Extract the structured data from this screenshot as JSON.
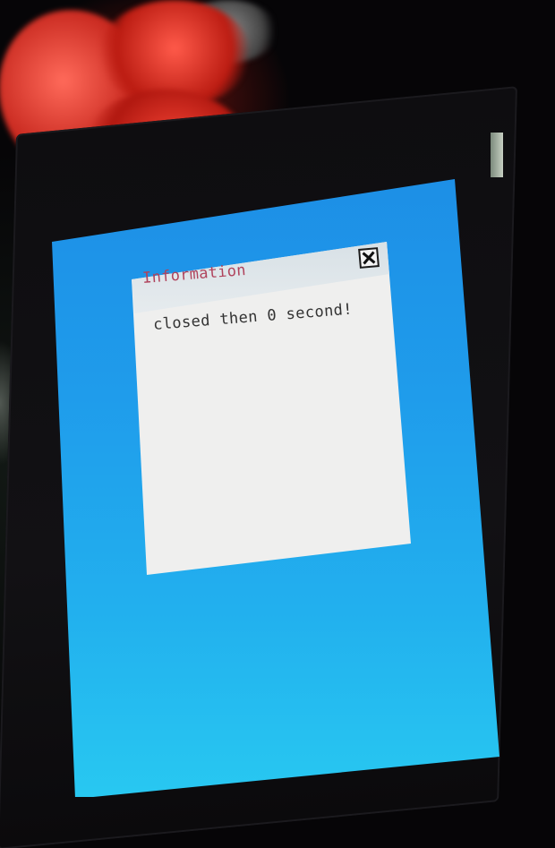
{
  "dialog": {
    "title": "Information",
    "message": "closed then 0 second!",
    "close_icon": "close-icon"
  },
  "colors": {
    "screen_background": "#1f9ceb",
    "dialog_background": "#efefee",
    "title_text": "#b0435c",
    "message_text": "#333333"
  }
}
